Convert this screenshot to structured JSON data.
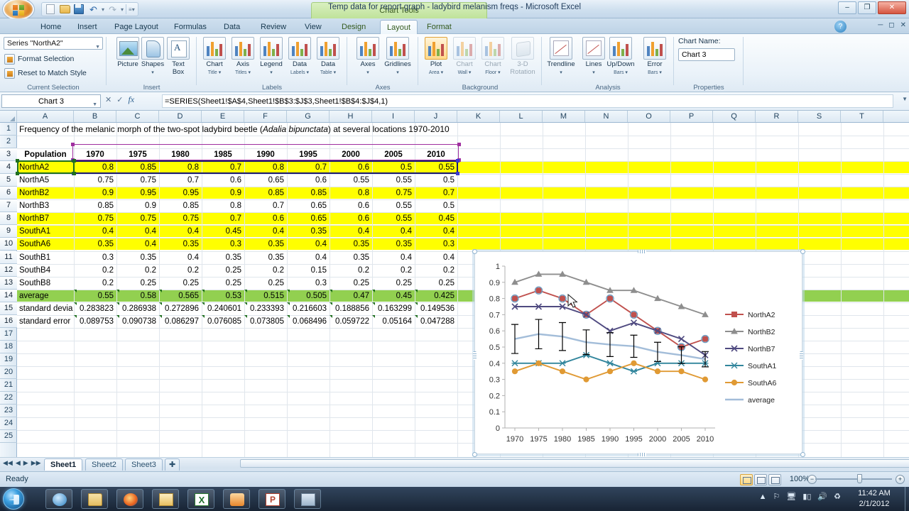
{
  "window": {
    "title": "Temp data for report graph - ladybird melanism freqs - Microsoft Excel",
    "contextual_tab_group": "Chart Tools",
    "minimize": "–",
    "restore": "❐",
    "close": "✕"
  },
  "quick_access": {
    "items": [
      "new-icon",
      "open-icon",
      "save-icon",
      "undo-icon",
      "redo-icon",
      "customize-qat-icon"
    ]
  },
  "tabs": [
    {
      "label": "Home",
      "active": false,
      "contextual": false
    },
    {
      "label": "Insert",
      "active": false,
      "contextual": false
    },
    {
      "label": "Page Layout",
      "active": false,
      "contextual": false
    },
    {
      "label": "Formulas",
      "active": false,
      "contextual": false
    },
    {
      "label": "Data",
      "active": false,
      "contextual": false
    },
    {
      "label": "Review",
      "active": false,
      "contextual": false
    },
    {
      "label": "View",
      "active": false,
      "contextual": false
    },
    {
      "label": "Design",
      "active": false,
      "contextual": true
    },
    {
      "label": "Layout",
      "active": true,
      "contextual": true
    },
    {
      "label": "Format",
      "active": false,
      "contextual": true
    }
  ],
  "ribbon": {
    "groups": [
      {
        "name": "Current Selection"
      },
      {
        "name": "Insert"
      },
      {
        "name": "Labels"
      },
      {
        "name": "Axes"
      },
      {
        "name": "Background"
      },
      {
        "name": "Analysis"
      },
      {
        "name": "Properties"
      }
    ],
    "current_selection": {
      "series_selector_value": "Series \"NorthA2\"",
      "format_selection": "Format Selection",
      "reset_to_match_style": "Reset to Match Style"
    },
    "insert": [
      {
        "label": "Picture",
        "sub": ""
      },
      {
        "label": "Shapes",
        "sub": "▾"
      },
      {
        "label": "Text",
        "sub": "Box"
      }
    ],
    "labels": [
      {
        "label": "Chart",
        "sub": "Title ▾"
      },
      {
        "label": "Axis",
        "sub": "Titles ▾"
      },
      {
        "label": "Legend",
        "sub": "▾"
      },
      {
        "label": "Data",
        "sub": "Labels ▾"
      },
      {
        "label": "Data",
        "sub": "Table ▾"
      }
    ],
    "axes": [
      {
        "label": "Axes",
        "sub": "▾"
      },
      {
        "label": "Gridlines",
        "sub": "▾"
      }
    ],
    "background": [
      {
        "label": "Plot",
        "sub": "Area ▾",
        "disabled": false
      },
      {
        "label": "Chart",
        "sub": "Wall ▾",
        "disabled": true
      },
      {
        "label": "Chart",
        "sub": "Floor ▾",
        "disabled": true
      },
      {
        "label": "3-D",
        "sub": "Rotation",
        "disabled": true
      }
    ],
    "analysis": [
      {
        "label": "Trendline",
        "sub": "▾"
      },
      {
        "label": "Lines",
        "sub": "▾"
      },
      {
        "label": "Up/Down",
        "sub": "Bars ▾"
      },
      {
        "label": "Error",
        "sub": "Bars ▾"
      }
    ],
    "properties": {
      "chart_name_label": "Chart Name:",
      "chart_name_value": "Chart 3"
    }
  },
  "formula_bar": {
    "name_box": "Chart 3",
    "formula": "=SERIES(Sheet1!$A$4,Sheet1!$B$3:$J$3,Sheet1!$B$4:$J$4,1)",
    "fx_label": "fx",
    "cancel": "✕",
    "enter": "✓"
  },
  "grid": {
    "columns": [
      "A",
      "B",
      "C",
      "D",
      "E",
      "F",
      "G",
      "H",
      "I",
      "J",
      "K",
      "L",
      "M",
      "N",
      "O",
      "P",
      "Q",
      "R",
      "S",
      "T"
    ],
    "rows": [
      1,
      2,
      3,
      4,
      5,
      6,
      7,
      8,
      9,
      10,
      11,
      12,
      13,
      14,
      15,
      16,
      17,
      18,
      19,
      20,
      21,
      22,
      23,
      24,
      25
    ],
    "title_row": {
      "row": 1,
      "text_before_italic": "Frequency of the melanic morph of the two-spot ladybird beetle (",
      "italic": "Adalia bipunctata",
      "text_after_italic": ") at several locations 1970-2010"
    },
    "header_row": {
      "row": 3,
      "cells": [
        "Population",
        "1970",
        "1975",
        "1980",
        "1985",
        "1990",
        "1995",
        "2000",
        "2005",
        "2010"
      ]
    },
    "data_rows": [
      {
        "row": 4,
        "label": "NorthA2",
        "values": [
          "0.8",
          "0.85",
          "0.8",
          "0.7",
          "0.8",
          "0.7",
          "0.6",
          "0.5",
          "0.55"
        ],
        "fill": "yellow"
      },
      {
        "row": 5,
        "label": "NorthA5",
        "values": [
          "0.75",
          "0.75",
          "0.7",
          "0.6",
          "0.65",
          "0.6",
          "0.55",
          "0.55",
          "0.5"
        ],
        "fill": "none"
      },
      {
        "row": 6,
        "label": "NorthB2",
        "values": [
          "0.9",
          "0.95",
          "0.95",
          "0.9",
          "0.85",
          "0.85",
          "0.8",
          "0.75",
          "0.7"
        ],
        "fill": "yellow"
      },
      {
        "row": 7,
        "label": "NorthB3",
        "values": [
          "0.85",
          "0.9",
          "0.85",
          "0.8",
          "0.7",
          "0.65",
          "0.6",
          "0.55",
          "0.5"
        ],
        "fill": "none"
      },
      {
        "row": 8,
        "label": "NorthB7",
        "values": [
          "0.75",
          "0.75",
          "0.75",
          "0.7",
          "0.6",
          "0.65",
          "0.6",
          "0.55",
          "0.45"
        ],
        "fill": "yellow"
      },
      {
        "row": 9,
        "label": "SouthA1",
        "values": [
          "0.4",
          "0.4",
          "0.4",
          "0.45",
          "0.4",
          "0.35",
          "0.4",
          "0.4",
          "0.4"
        ],
        "fill": "yellow"
      },
      {
        "row": 10,
        "label": "SouthA6",
        "values": [
          "0.35",
          "0.4",
          "0.35",
          "0.3",
          "0.35",
          "0.4",
          "0.35",
          "0.35",
          "0.3"
        ],
        "fill": "yellow"
      },
      {
        "row": 11,
        "label": "SouthB1",
        "values": [
          "0.3",
          "0.35",
          "0.4",
          "0.35",
          "0.35",
          "0.4",
          "0.35",
          "0.4",
          "0.4"
        ],
        "fill": "none"
      },
      {
        "row": 12,
        "label": "SouthB4",
        "values": [
          "0.2",
          "0.2",
          "0.2",
          "0.25",
          "0.2",
          "0.15",
          "0.2",
          "0.2",
          "0.2"
        ],
        "fill": "none"
      },
      {
        "row": 13,
        "label": "SouthB8",
        "values": [
          "0.2",
          "0.25",
          "0.25",
          "0.25",
          "0.25",
          "0.3",
          "0.25",
          "0.25",
          "0.25"
        ],
        "fill": "none"
      },
      {
        "row": 14,
        "label": "average",
        "values": [
          "0.55",
          "0.58",
          "0.565",
          "0.53",
          "0.515",
          "0.505",
          "0.47",
          "0.45",
          "0.425"
        ],
        "fill": "green"
      },
      {
        "row": 15,
        "label": "standard devia",
        "values": [
          "0.283823",
          "0.286938",
          "0.272896",
          "0.240601",
          "0.233393",
          "0.216603",
          "0.188856",
          "0.163299",
          "0.149536"
        ],
        "fill": "none"
      },
      {
        "row": 16,
        "label": "standard error",
        "values": [
          "0.089753",
          "0.090738",
          "0.086297",
          "0.076085",
          "0.073805",
          "0.068496",
          "0.059722",
          "0.05164",
          "0.047288"
        ],
        "fill": "none"
      }
    ]
  },
  "chart_data": {
    "type": "line",
    "title": "",
    "xlabel": "",
    "ylabel": "",
    "ylim": [
      0,
      1
    ],
    "yticks": [
      "0",
      "0.1",
      "0.2",
      "0.3",
      "0.4",
      "0.5",
      "0.6",
      "0.7",
      "0.8",
      "0.9",
      "1"
    ],
    "categories": [
      "1970",
      "1975",
      "1980",
      "1985",
      "1990",
      "1995",
      "2000",
      "2005",
      "2010"
    ],
    "grid": false,
    "legend_position": "right",
    "series": [
      {
        "name": "NorthA2",
        "color": "#c0504d",
        "marker": "square",
        "values": [
          0.8,
          0.85,
          0.8,
          0.7,
          0.8,
          0.7,
          0.6,
          0.5,
          0.55
        ],
        "selected": true
      },
      {
        "name": "NorthB2",
        "color": "#8e8e8e",
        "marker": "triangle",
        "values": [
          0.9,
          0.95,
          0.95,
          0.9,
          0.85,
          0.85,
          0.8,
          0.75,
          0.7
        ],
        "selected": false
      },
      {
        "name": "NorthB7",
        "color": "#4f4a80",
        "marker": "x",
        "values": [
          0.75,
          0.75,
          0.75,
          0.7,
          0.6,
          0.65,
          0.6,
          0.55,
          0.45
        ],
        "selected": false
      },
      {
        "name": "SouthA1",
        "color": "#31859c",
        "marker": "asterisk",
        "values": [
          0.4,
          0.4,
          0.4,
          0.45,
          0.4,
          0.35,
          0.4,
          0.4,
          0.4
        ],
        "selected": false
      },
      {
        "name": "SouthA6",
        "color": "#e09a34",
        "marker": "circle",
        "values": [
          0.35,
          0.4,
          0.35,
          0.3,
          0.35,
          0.4,
          0.35,
          0.35,
          0.3
        ],
        "selected": false
      },
      {
        "name": "average",
        "color": "#a3bdd9",
        "marker": "none",
        "values": [
          0.55,
          0.58,
          0.565,
          0.53,
          0.515,
          0.505,
          0.47,
          0.45,
          0.425
        ],
        "error_bars": [
          0.089753,
          0.090738,
          0.086297,
          0.076085,
          0.073805,
          0.068496,
          0.059722,
          0.05164,
          0.047288
        ],
        "selected": false
      }
    ]
  },
  "sheet_tabs": {
    "nav": [
      "first-sheet-icon",
      "prev-sheet-icon",
      "next-sheet-icon",
      "last-sheet-icon"
    ],
    "tabs": [
      {
        "label": "Sheet1",
        "active": true
      },
      {
        "label": "Sheet2",
        "active": false
      },
      {
        "label": "Sheet3",
        "active": false
      }
    ],
    "insert_sheet": "insert-worksheet-icon"
  },
  "status_bar": {
    "status": "Ready",
    "zoom": "100%",
    "views": [
      "normal-view-icon",
      "page-layout-view-icon",
      "page-break-preview-icon"
    ],
    "zoom_out": "−",
    "zoom_in": "+"
  },
  "taskbar": {
    "start": "start-orb-icon",
    "buttons": [
      "internet-explorer-icon",
      "windows-explorer-icon",
      "firefox-icon",
      "outlook-icon",
      "excel-icon",
      "media-player-icon",
      "powerpoint-icon",
      "movie-maker-icon"
    ],
    "tray": [
      "show-hidden-icons-icon",
      "flag-action-center-icon",
      "network-share-icon",
      "signal-icon",
      "volume-icon",
      "sync-icon"
    ],
    "time": "11:42 AM",
    "date": "2/1/2012"
  }
}
